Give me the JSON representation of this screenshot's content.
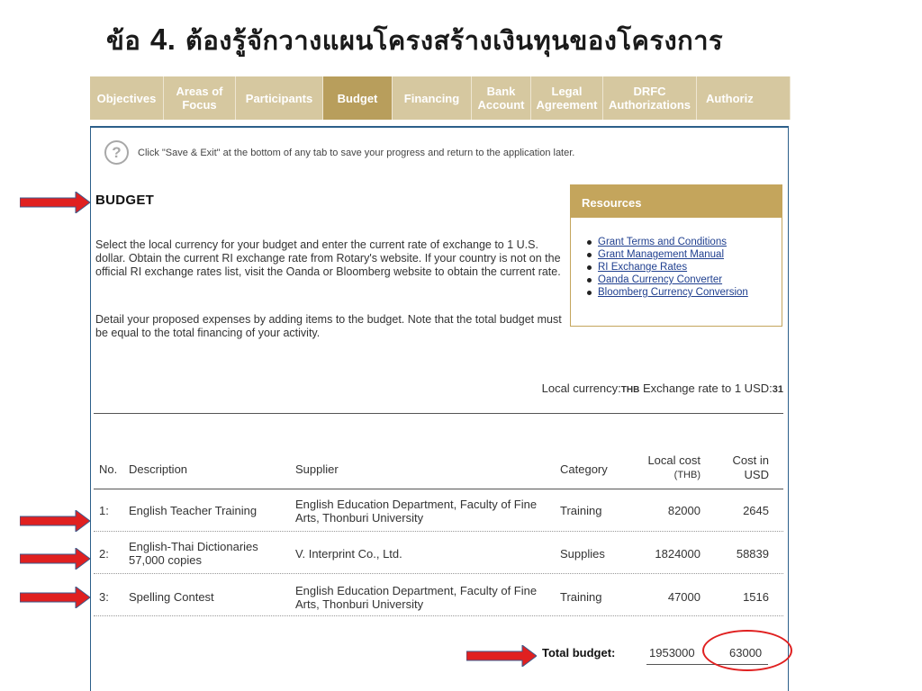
{
  "slide": {
    "title_prefix": "ข้อ",
    "title_number": "4.",
    "title_text": "ต้องรู้จักวางแผนโครงสร้างเงินทุนของโครงการ"
  },
  "tabs": [
    {
      "label": "Objectives",
      "active": false
    },
    {
      "label": "Areas of\nFocus",
      "active": false
    },
    {
      "label": "Participants",
      "active": false
    },
    {
      "label": "Budget",
      "active": true
    },
    {
      "label": "Financing",
      "active": false
    },
    {
      "label": "Bank\nAccount",
      "active": false
    },
    {
      "label": "Legal\nAgreement",
      "active": false
    },
    {
      "label": "DRFC\nAuthorizations",
      "active": false
    },
    {
      "label": "Authoriz",
      "active": false
    }
  ],
  "help": {
    "icon": "question-circle-icon",
    "text": "Click \"Save & Exit\" at the bottom of any tab to save your progress and return to the application later."
  },
  "budget": {
    "heading": "BUDGET",
    "paragraph1": "Select the local currency for your budget and enter the current rate of exchange to 1 U.S. dollar. Obtain the current RI exchange rate from Rotary's website. If your country is not on the official RI exchange rates list, visit the Oanda or Bloomberg website to obtain the current rate.",
    "paragraph2": "Detail your proposed expenses by adding items to the budget. Note that the total budget must be equal to the total financing of your activity.",
    "currency_label": "Local currency:",
    "currency_code": "THB",
    "rate_label": " Exchange rate to 1 USD:",
    "rate_value": "31"
  },
  "resources": {
    "title": "Resources",
    "links": [
      "Grant Terms and Conditions",
      "Grant Management Manual",
      "RI Exchange Rates",
      "Oanda Currency Converter",
      "Bloomberg Currency Conversion"
    ]
  },
  "table": {
    "headers": {
      "no": "No.",
      "description": "Description",
      "supplier": "Supplier",
      "category": "Category",
      "local_cost_line1": "Local cost",
      "local_cost_line2": "(THB)",
      "usd_line1": "Cost in",
      "usd_line2": "USD"
    },
    "rows": [
      {
        "no": "1:",
        "description": "English Teacher Training",
        "supplier": "English Education Department, Faculty of Fine Arts, Thonburi University",
        "category": "Training",
        "local": "82000",
        "usd": "2645"
      },
      {
        "no": "2:",
        "description": "English-Thai Dictionaries 57,000 copies",
        "supplier": "V. Interprint Co., Ltd.",
        "category": "Supplies",
        "local": "1824000",
        "usd": "58839"
      },
      {
        "no": "3:",
        "description": "Spelling Contest",
        "supplier": "English Education Department, Faculty of Fine Arts, Thonburi University",
        "category": "Training",
        "local": "47000",
        "usd": "1516"
      }
    ],
    "total_label": "Total budget:",
    "total_local": "1953000",
    "total_usd": "63000"
  },
  "colors": {
    "tab_inactive": "#d6c8a0",
    "tab_active": "#b89e5c",
    "resources_accent": "#c4a55c",
    "panel_border": "#2c5f8a",
    "annotation_red": "#e02020",
    "link_blue": "#1f3f8f"
  }
}
